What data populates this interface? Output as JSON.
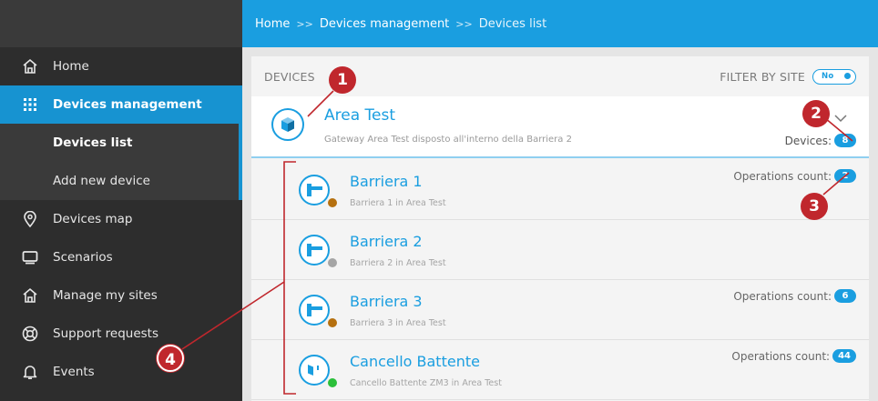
{
  "breadcrumb": [
    "Home",
    "Devices management",
    "Devices list"
  ],
  "breadcrumb_separator": ">>",
  "sidebar": {
    "items": [
      {
        "label": "Home",
        "icon": "home-icon"
      },
      {
        "label": "Devices management",
        "icon": "grid-icon"
      },
      {
        "label": "Devices list"
      },
      {
        "label": "Add new device"
      },
      {
        "label": "Devices map",
        "icon": "map-pin-icon"
      },
      {
        "label": "Scenarios",
        "icon": "monitor-icon"
      },
      {
        "label": "Manage my sites",
        "icon": "home-icon"
      },
      {
        "label": "Support requests",
        "icon": "lifebuoy-icon"
      },
      {
        "label": "Events",
        "icon": "bell-icon"
      }
    ]
  },
  "devices_panel": {
    "title": "DEVICES",
    "filter_label": "FILTER BY SITE",
    "filter_toggle": "No"
  },
  "area": {
    "name": "Area Test",
    "description": "Gateway Area Test disposto all'interno della Barriera 2",
    "devices_label": "Devices:",
    "devices_count": "8"
  },
  "devices": [
    {
      "name": "Barriera 1",
      "subtitle": "Barriera 1 in Area Test",
      "status_color": "#b5700f",
      "ops_label": "Operations count:",
      "ops_count": "2",
      "icon": "barrier-icon"
    },
    {
      "name": "Barriera 2",
      "subtitle": "Barriera 2 in Area Test",
      "status_color": "#a5a5a5",
      "ops_label": "",
      "ops_count": "",
      "icon": "barrier-icon"
    },
    {
      "name": "Barriera 3",
      "subtitle": "Barriera 3 in Area Test",
      "status_color": "#b5700f",
      "ops_label": "Operations count:",
      "ops_count": "6",
      "icon": "barrier-icon"
    },
    {
      "name": "Cancello Battente",
      "subtitle": "Cancello Battente ZM3 in Area Test",
      "status_color": "#2bbf3a",
      "ops_label": "Operations count:",
      "ops_count": "44",
      "icon": "gate-icon"
    }
  ],
  "annotations": [
    "1",
    "2",
    "3",
    "4"
  ],
  "colors": {
    "accent": "#1a9ee0",
    "sidebar": "#2d2d2d",
    "annotation": "#c0272d"
  }
}
